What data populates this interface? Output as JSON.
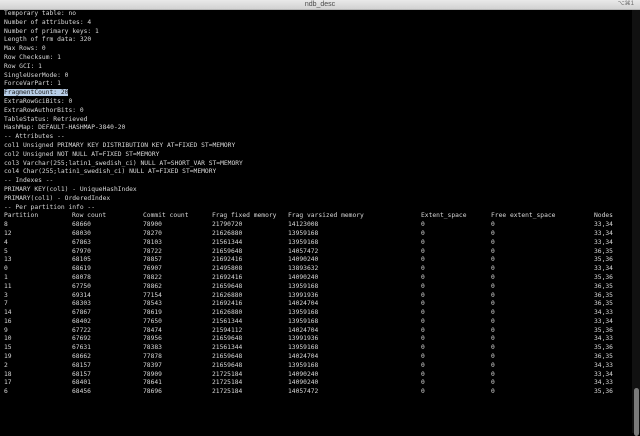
{
  "window": {
    "title": "ndb_desc",
    "shortcut": "⌥⌘1"
  },
  "header_lines": [
    "Temporary table: no",
    "Number of attributes: 4",
    "Number of primary keys: 1",
    "Length of frm data: 320",
    "Max Rows: 0",
    "Row Checksum: 1",
    "Row GCI: 1",
    "SingleUserMode: 0",
    "ForceVarPart: 1"
  ],
  "highlighted_line": "FragmentCount: 20",
  "footer_lines": [
    "ExtraRowGciBits: 0",
    "ExtraRowAuthorBits: 0",
    "TableStatus: Retrieved",
    "HashMap: DEFAULT-HASHMAP-3840-20",
    "-- Attributes --",
    "col1 Unsigned PRIMARY KEY DISTRIBUTION KEY AT=FIXED ST=MEMORY",
    "col2 Unsigned NOT NULL AT=FIXED ST=MEMORY",
    "col3 Varchar(255;latin1_swedish_ci) NULL AT=SHORT_VAR ST=MEMORY",
    "col4 Char(255;latin1_swedish_ci) NULL AT=FIXED ST=MEMORY",
    "-- Indexes --",
    "PRIMARY KEY(col1) - UniqueHashIndex",
    "PRIMARY(col1) - OrderedIndex",
    "-- Per partition info --"
  ],
  "table": {
    "headers": [
      "Partition",
      "Row count",
      "Commit count",
      "Frag fixed memory",
      "Frag varsized memory",
      "Extent_space",
      "Free extent_space",
      "Nodes"
    ],
    "rows": [
      [
        "8",
        "68660",
        "78900",
        "21790720",
        "14123008",
        "0",
        "0",
        "33,34"
      ],
      [
        "12",
        "68030",
        "78270",
        "21626880",
        "13959168",
        "0",
        "0",
        "33,34"
      ],
      [
        "4",
        "67863",
        "78103",
        "21561344",
        "13959168",
        "0",
        "0",
        "33,34"
      ],
      [
        "5",
        "67970",
        "78722",
        "21659648",
        "14057472",
        "0",
        "0",
        "36,35"
      ],
      [
        "13",
        "68105",
        "78857",
        "21692416",
        "14090240",
        "0",
        "0",
        "35,36"
      ],
      [
        "0",
        "68619",
        "76907",
        "21495808",
        "13893632",
        "0",
        "0",
        "33,34"
      ],
      [
        "1",
        "68078",
        "78822",
        "21692416",
        "14090240",
        "0",
        "0",
        "35,36"
      ],
      [
        "11",
        "67750",
        "78862",
        "21659648",
        "13959168",
        "0",
        "0",
        "36,35"
      ],
      [
        "3",
        "69314",
        "77154",
        "21626880",
        "13991936",
        "0",
        "0",
        "36,35"
      ],
      [
        "7",
        "68303",
        "78543",
        "21692416",
        "14024704",
        "0",
        "0",
        "36,35"
      ],
      [
        "14",
        "67867",
        "78619",
        "21626880",
        "13959168",
        "0",
        "0",
        "34,33"
      ],
      [
        "16",
        "68402",
        "77650",
        "21561344",
        "13959168",
        "0",
        "0",
        "33,34"
      ],
      [
        "9",
        "67722",
        "78474",
        "21594112",
        "14024704",
        "0",
        "0",
        "35,36"
      ],
      [
        "10",
        "67692",
        "78956",
        "21659648",
        "13991936",
        "0",
        "0",
        "34,33"
      ],
      [
        "15",
        "67631",
        "78383",
        "21561344",
        "13959168",
        "0",
        "0",
        "35,36"
      ],
      [
        "19",
        "68662",
        "77878",
        "21659648",
        "14024704",
        "0",
        "0",
        "36,35"
      ],
      [
        "2",
        "68157",
        "78397",
        "21659648",
        "13959168",
        "0",
        "0",
        "34,33"
      ],
      [
        "18",
        "68157",
        "78909",
        "21725184",
        "14090240",
        "0",
        "0",
        "33,34"
      ],
      [
        "17",
        "68401",
        "78641",
        "21725184",
        "14090240",
        "0",
        "0",
        "34,33"
      ],
      [
        "6",
        "68456",
        "78696",
        "21725184",
        "14057472",
        "0",
        "0",
        "35,36"
      ]
    ]
  }
}
